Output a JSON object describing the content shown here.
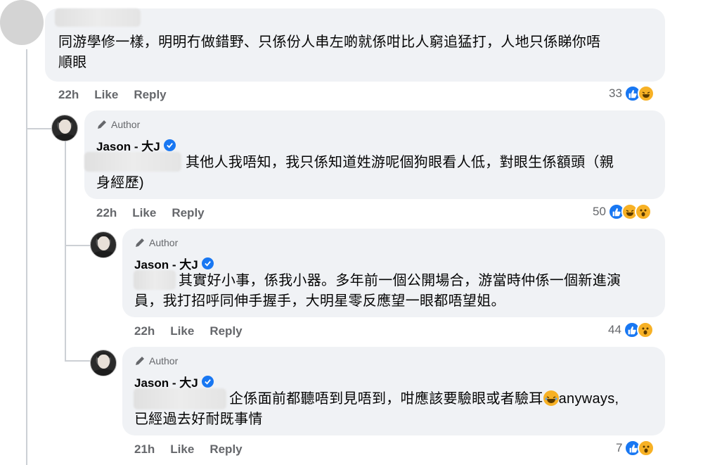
{
  "comments": [
    {
      "text_line1": "同游學修一樣，明明冇做錯野、只係份人串左啲就係咁比人窮追猛打，人地只係睇你唔",
      "text_line2": "順眼",
      "time": "22h",
      "like": "Like",
      "reply": "Reply",
      "reaction_count": "33",
      "reactions": [
        "like-icon",
        "haha-icon"
      ]
    },
    {
      "author_badge": "Author",
      "name": "Jason - 大J",
      "text_line1": "其他人我唔知，我只係知道姓游呢個狗眼看人低，對眼生係額頭（親",
      "text_line2": "身經歷)",
      "time": "22h",
      "like": "Like",
      "reply": "Reply",
      "reaction_count": "50",
      "reactions": [
        "like-icon",
        "haha-icon",
        "wow-icon"
      ]
    },
    {
      "author_badge": "Author",
      "name": "Jason - 大J",
      "text_line1": "其實好小事，係我小器。多年前一個公開場合，游當時仲係一個新進演",
      "text_line2": "員，我打招呼同伸手握手，大明星零反應望一眼都唔望姐。",
      "time": "22h",
      "like": "Like",
      "reply": "Reply",
      "reaction_count": "44",
      "reactions": [
        "like-icon",
        "wow-icon"
      ]
    },
    {
      "author_badge": "Author",
      "name": "Jason - 大J",
      "text_line1a": "企係面前都聽唔到見唔到，咁應該要驗眼或者驗耳",
      "text_line1b": "anyways,",
      "text_line2": "已經過去好耐既事情",
      "time": "21h",
      "like": "Like",
      "reply": "Reply",
      "reaction_count": "7",
      "reactions": [
        "like-icon",
        "wow-icon"
      ]
    }
  ],
  "colors": {
    "like": "#1877f2",
    "emoji": "#f7b125",
    "bubble": "#f0f2f5",
    "meta": "#65676b"
  }
}
